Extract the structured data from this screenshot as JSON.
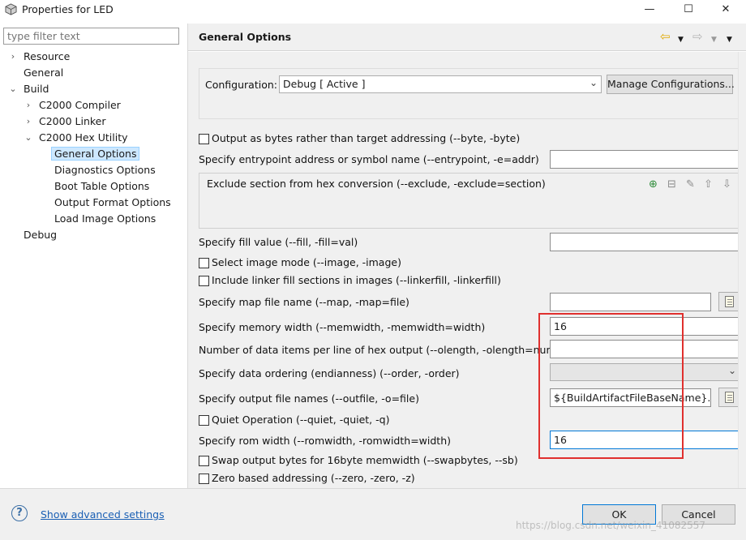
{
  "window": {
    "title": "Properties for LED",
    "minimize": "—",
    "maximize": "☐",
    "close": "✕"
  },
  "tree": {
    "filter_placeholder": "type filter text",
    "resource": "Resource",
    "general": "General",
    "build": "Build",
    "compiler": "C2000 Compiler",
    "linker": "C2000 Linker",
    "hex_utility": "C2000 Hex Utility",
    "general_options": "General Options",
    "diagnostics": "Diagnostics Options",
    "boot_table": "Boot Table Options",
    "output_format": "Output Format Options",
    "load_image": "Load Image Options",
    "debug": "Debug"
  },
  "header": {
    "title": "General Options"
  },
  "configuration": {
    "label": "Configuration:",
    "value": "Debug  [ Active ]",
    "manage_button": "Manage Configurations..."
  },
  "options": {
    "byte_label": "Output as bytes rather than target addressing (--byte, -byte)",
    "entrypoint_label": "Specify entrypoint address or symbol name (--entrypoint, -e=addr)",
    "entrypoint_value": "",
    "exclude_label": "Exclude section from hex conversion (--exclude, -exclude=section)",
    "fill_label": "Specify fill value (--fill, -fill=val)",
    "fill_value": "",
    "image_label": "Select image mode (--image, -image)",
    "linkerfill_label": "Include linker fill sections in images (--linkerfill, -linkerfill)",
    "map_label": "Specify map file name (--map, -map=file)",
    "map_value": "",
    "memwidth_label": "Specify memory width (--memwidth, -memwidth=width)",
    "memwidth_value": "16",
    "olength_label": "Number of data items per line of hex output (--olength, -olength=num)",
    "olength_value": "",
    "order_label": "Specify data ordering (endianness) (--order, -order)",
    "order_value": "",
    "outfile_label": "Specify output file names (--outfile, -o=file)",
    "outfile_value": "${BuildArtifactFileBaseName}.hex",
    "quiet_label": "Quiet Operation (--quiet, -quiet, -q)",
    "romwidth_label": "Specify rom width (--romwidth, -romwidth=width)",
    "romwidth_value": "16",
    "swapbytes_label": "Swap output bytes for 16byte memwidth (--swapbytes, --sb)",
    "zero_label": "Zero based addressing (--zero, -zero, -z)"
  },
  "footer": {
    "help": "?",
    "advanced_link": "Show advanced settings",
    "ok": "OK",
    "cancel": "Cancel",
    "watermark": "https://blog.csdn.net/weixin_41082557"
  },
  "colors": {
    "highlight_box": "#e0302e",
    "selection": "#cde8ff",
    "link": "#1a5fb4"
  }
}
